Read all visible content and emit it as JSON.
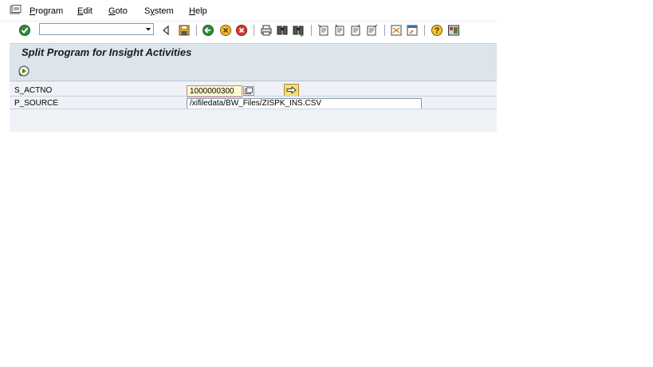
{
  "menu": {
    "items": [
      {
        "underline": "P",
        "rest": "rogram"
      },
      {
        "underline": "E",
        "rest": "dit"
      },
      {
        "underline": "G",
        "rest": "oto"
      },
      {
        "underline": "",
        "rest": "System",
        "mid": "y"
      },
      {
        "underline": "H",
        "rest": "elp"
      }
    ],
    "program": {
      "u": "P",
      "r": "rogram"
    },
    "edit": {
      "u": "E",
      "r": "dit"
    },
    "goto": {
      "u": "G",
      "r": "oto"
    },
    "system": {
      "a": "S",
      "u": "y",
      "r": "stem"
    },
    "help": {
      "u": "H",
      "r": "elp"
    }
  },
  "toolbar": {
    "command_field_value": "",
    "icons": [
      "enter-icon",
      "back-icon",
      "save-icon",
      "back-green-icon",
      "exit-icon",
      "cancel-icon",
      "print-icon",
      "find-icon",
      "find-next-icon",
      "first-page-icon",
      "previous-page-icon",
      "next-page-icon",
      "last-page-icon",
      "create-session-icon",
      "shortcut-icon",
      "help-icon",
      "layout-icon"
    ]
  },
  "title": "Split Program for Insight Activities",
  "selection": {
    "s_actno": {
      "label": "S_ACTNO",
      "value": "1000000300"
    },
    "p_source": {
      "label": "P_SOURCE",
      "value": "/xifiledata/BW_Files/ZISPK_INS.CSV"
    }
  },
  "colors": {
    "title_bg": "#dce4ec",
    "content_bg": "#eef2f6",
    "required_field": "#fffbd0",
    "accent_yellow": "#f4dd78"
  }
}
